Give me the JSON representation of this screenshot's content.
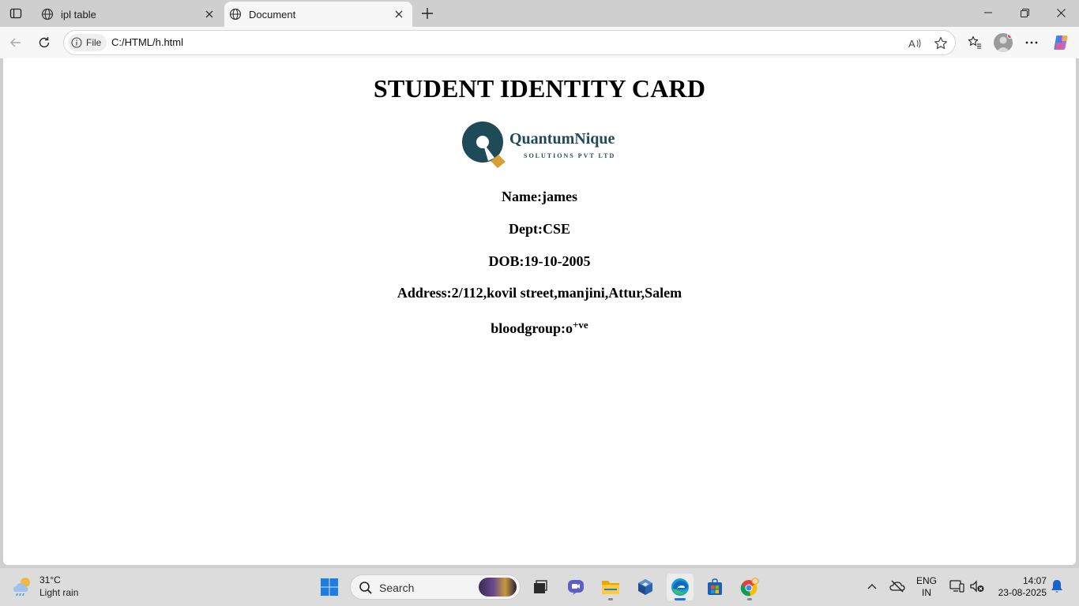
{
  "browser": {
    "tabs": [
      {
        "title": "ipl table",
        "active": false
      },
      {
        "title": "Document",
        "active": true
      }
    ],
    "site_info_label": "File",
    "url": "C:/HTML/h.html"
  },
  "page": {
    "heading": "STUDENT IDENTITY CARD",
    "logo": {
      "name": "QuantumNique",
      "tagline": "SOLUTIONS PVT LTD"
    },
    "fields": [
      {
        "label": "Name:",
        "value": "james"
      },
      {
        "label": "Dept:",
        "value": "CSE"
      },
      {
        "label": "DOB:",
        "value": "19-10-2005"
      },
      {
        "label": "Address:",
        "value": "2/112,kovil street,manjini,Attur,Salem"
      }
    ],
    "blood": {
      "label": "bloodgroup:",
      "value": "o",
      "sup": "+ve"
    }
  },
  "taskbar": {
    "weather": {
      "temp": "31°C",
      "condition": "Light rain"
    },
    "search_label": "Search",
    "language": {
      "line1": "ENG",
      "line2": "IN"
    },
    "clock": {
      "time": "14:07",
      "date": "23-08-2025"
    }
  },
  "colors": {
    "logo_teal": "#1f4a57",
    "logo_gold": "#d4a03a",
    "edge_blue": "#1a73e8"
  }
}
